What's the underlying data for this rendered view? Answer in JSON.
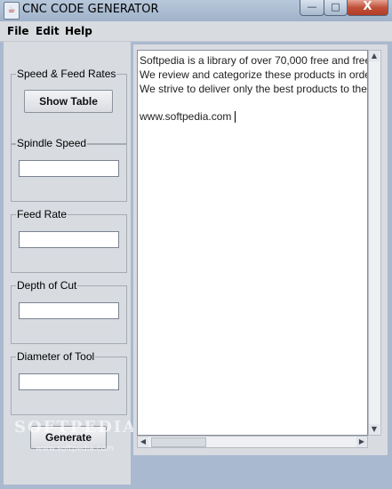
{
  "window": {
    "title": "CNC CODE GENERATOR",
    "icon": "java-cup-icon",
    "controls": {
      "minimize": "—",
      "maximize": "□",
      "close": "X"
    }
  },
  "menubar": {
    "items": [
      "File",
      "Edit",
      "Help"
    ]
  },
  "left_panel": {
    "speed_feed": {
      "label": "Speed & Feed Rates",
      "button_label": "Show Table"
    },
    "spindle_speed": {
      "label": "Spindle Speed",
      "value": ""
    },
    "feed_rate": {
      "label": "Feed Rate",
      "value": ""
    },
    "depth_of_cut": {
      "label": "Depth of Cut",
      "value": ""
    },
    "diameter_of_tool": {
      "label": "Diameter of Tool",
      "value": ""
    },
    "generate_label": "Generate"
  },
  "editor": {
    "lines": [
      "Softpedia is a library of over 70,000 free and free",
      "We review and categorize these products in orde",
      "We strive to deliver only the best products to the"
    ],
    "url": "www.softpedia.com"
  },
  "watermark": {
    "text": "SOFTPEDIA",
    "url": "www.softpedia.com"
  }
}
